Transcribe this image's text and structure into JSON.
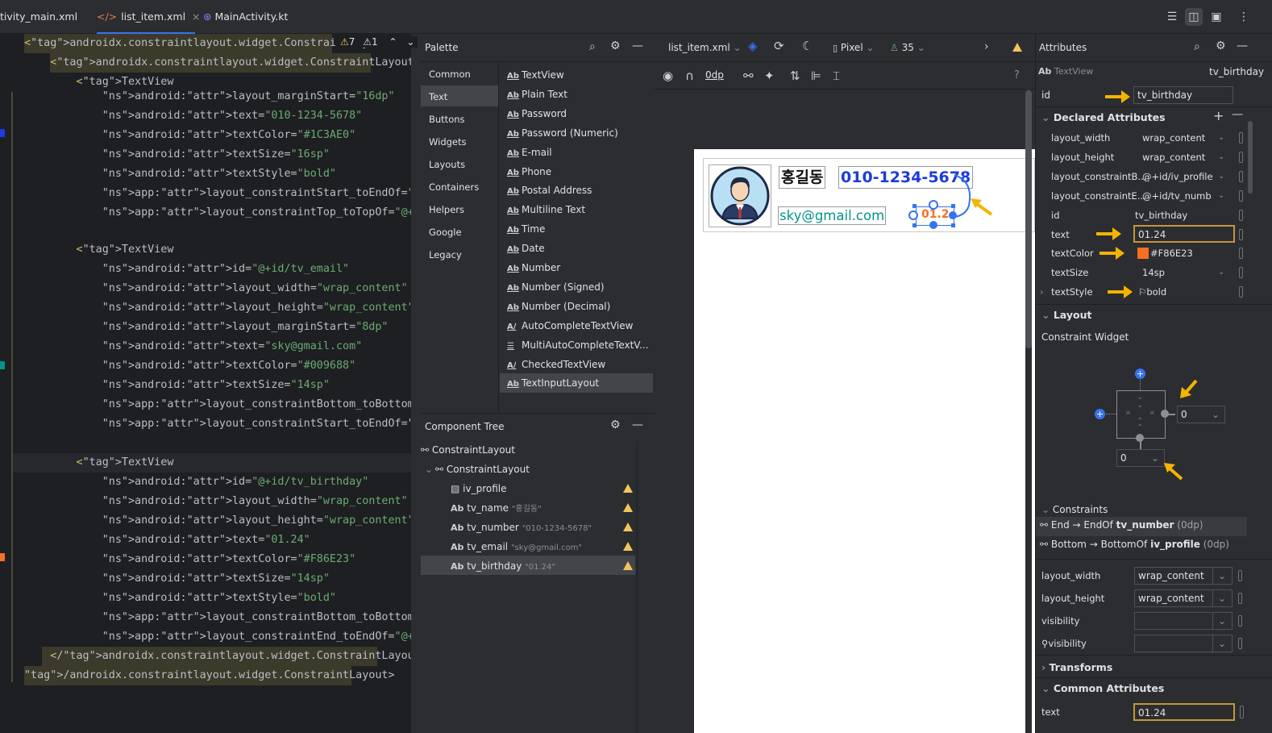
{
  "tabs": [
    {
      "label": "tivity_main.xml"
    },
    {
      "label": "list_item.xml"
    },
    {
      "label": "MainActivity.kt"
    }
  ],
  "tab_close": "×",
  "warnings": {
    "a": "7",
    "b": "1"
  },
  "code_lines": [
    "<androidx.constraintlayout.widget.ConstraintLayo",
    "    <androidx.constraintlayout.widget.ConstraintLayout",
    "        <TextView",
    "            android:layout_marginStart=\"16dp\"",
    "            android:text=\"010-1234-5678\"",
    "            android:textColor=\"#1C3AE0\"",
    "            android:textSize=\"16sp\"",
    "            android:textStyle=\"bold\"",
    "            app:layout_constraintStart_toEndOf=\"@+id/tv_name\"",
    "            app:layout_constraintTop_toTopOf=\"@+id/iv_profile\"",
    "",
    "        <TextView",
    "            android:id=\"@+id/tv_email\"",
    "            android:layout_width=\"wrap_content\"",
    "            android:layout_height=\"wrap_content\"",
    "            android:layout_marginStart=\"8dp\"",
    "            android:text=\"sky@gmail.com\"",
    "            android:textColor=\"#009688\"",
    "            android:textSize=\"14sp\"",
    "            app:layout_constraintBottom_toBottomOf=\"@+id/iv_pro",
    "            app:layout_constraintStart_toEndOf=\"@+id/iv_profile",
    "",
    "        <TextView",
    "            android:id=\"@+id/tv_birthday\"",
    "            android:layout_width=\"wrap_content\"",
    "            android:layout_height=\"wrap_content\"",
    "            android:text=\"01.24\"",
    "            android:textColor=\"#F86E23\"",
    "            android:textSize=\"14sp\"",
    "            android:textStyle=\"bold\"",
    "            app:layout_constraintBottom_toBottomOf=\"@+id/iv_pro",
    "            app:layout_constraintEnd_toEndOf=\"@+id/tv_number\" /",
    "    </androidx.constraintlayout.widget.ConstraintLayout>",
    "/androidx.constraintlayout.widget.ConstraintLayout>"
  ],
  "palette": {
    "title": "Palette",
    "categories": [
      "Common",
      "Text",
      "Buttons",
      "Widgets",
      "Layouts",
      "Containers",
      "Helpers",
      "Google",
      "Legacy"
    ],
    "selected_category": "Text",
    "items": [
      "TextView",
      "Plain Text",
      "Password",
      "Password (Numeric)",
      "E-mail",
      "Phone",
      "Postal Address",
      "Multiline Text",
      "Time",
      "Date",
      "Number",
      "Number (Signed)",
      "Number (Decimal)",
      "AutoCompleteTextView",
      "MultiAutoCompleteTextV...",
      "CheckedTextView",
      "TextInputLayout"
    ]
  },
  "tree": {
    "title": "Component Tree",
    "rows": [
      {
        "label": "ConstraintLayout",
        "hint": ""
      },
      {
        "label": "ConstraintLayout",
        "hint": ""
      },
      {
        "label": "iv_profile",
        "hint": ""
      },
      {
        "label": "tv_name",
        "hint": "\"홍길동\""
      },
      {
        "label": "tv_number",
        "hint": "\"010-1234-5678\""
      },
      {
        "label": "tv_email",
        "hint": "\"sky@gmail.com\""
      },
      {
        "label": "tv_birthday",
        "hint": "\"01.24\""
      }
    ]
  },
  "design_toolbar": {
    "file": "list_item.xml",
    "device": "Pixel",
    "api": "35",
    "margin": "0dp"
  },
  "preview": {
    "name": "홍길동",
    "number": "010-1234-5678",
    "email": "sky@gmail.com",
    "birthday": "01.24",
    "number_color": "#1C3AE0",
    "email_color": "#009688",
    "birthday_color": "#F86E23"
  },
  "attributes": {
    "title": "Attributes",
    "view_type": "TextView",
    "view_id": "tv_birthday",
    "id_label": "id",
    "id_value": "tv_birthday",
    "declared_title": "Declared Attributes",
    "declared": [
      {
        "name": "layout_width",
        "value": "wrap_content"
      },
      {
        "name": "layout_height",
        "value": "wrap_content"
      },
      {
        "name": "layout_constraintB...",
        "value": "@+id/iv_profile"
      },
      {
        "name": "layout_constraintE...",
        "value": "@+id/tv_numb"
      },
      {
        "name": "id",
        "value": "tv_birthday"
      },
      {
        "name": "text",
        "value": "01.24"
      },
      {
        "name": "textColor",
        "value": "#F86E23"
      },
      {
        "name": "textSize",
        "value": "14sp"
      },
      {
        "name": "textStyle",
        "value": "bold"
      }
    ],
    "layout_title": "Layout",
    "constraint_widget": "Constraint Widget",
    "margin_right": "0",
    "margin_bottom": "0",
    "constraints_title": "Constraints",
    "constraints": [
      {
        "prefix": "End → EndOf ",
        "target": "tv_number",
        "suffix": " (0dp)"
      },
      {
        "prefix": "Bottom → BottomOf ",
        "target": "iv_profile",
        "suffix": " (0dp)"
      }
    ],
    "layout_rows": [
      {
        "name": "layout_width",
        "value": "wrap_content"
      },
      {
        "name": "layout_height",
        "value": "wrap_content"
      },
      {
        "name": "visibility",
        "value": ""
      },
      {
        "name": "visibility",
        "value": ""
      }
    ],
    "transforms_title": "Transforms",
    "common_title": "Common Attributes",
    "common_text_label": "text",
    "common_text_value": "01.24"
  }
}
